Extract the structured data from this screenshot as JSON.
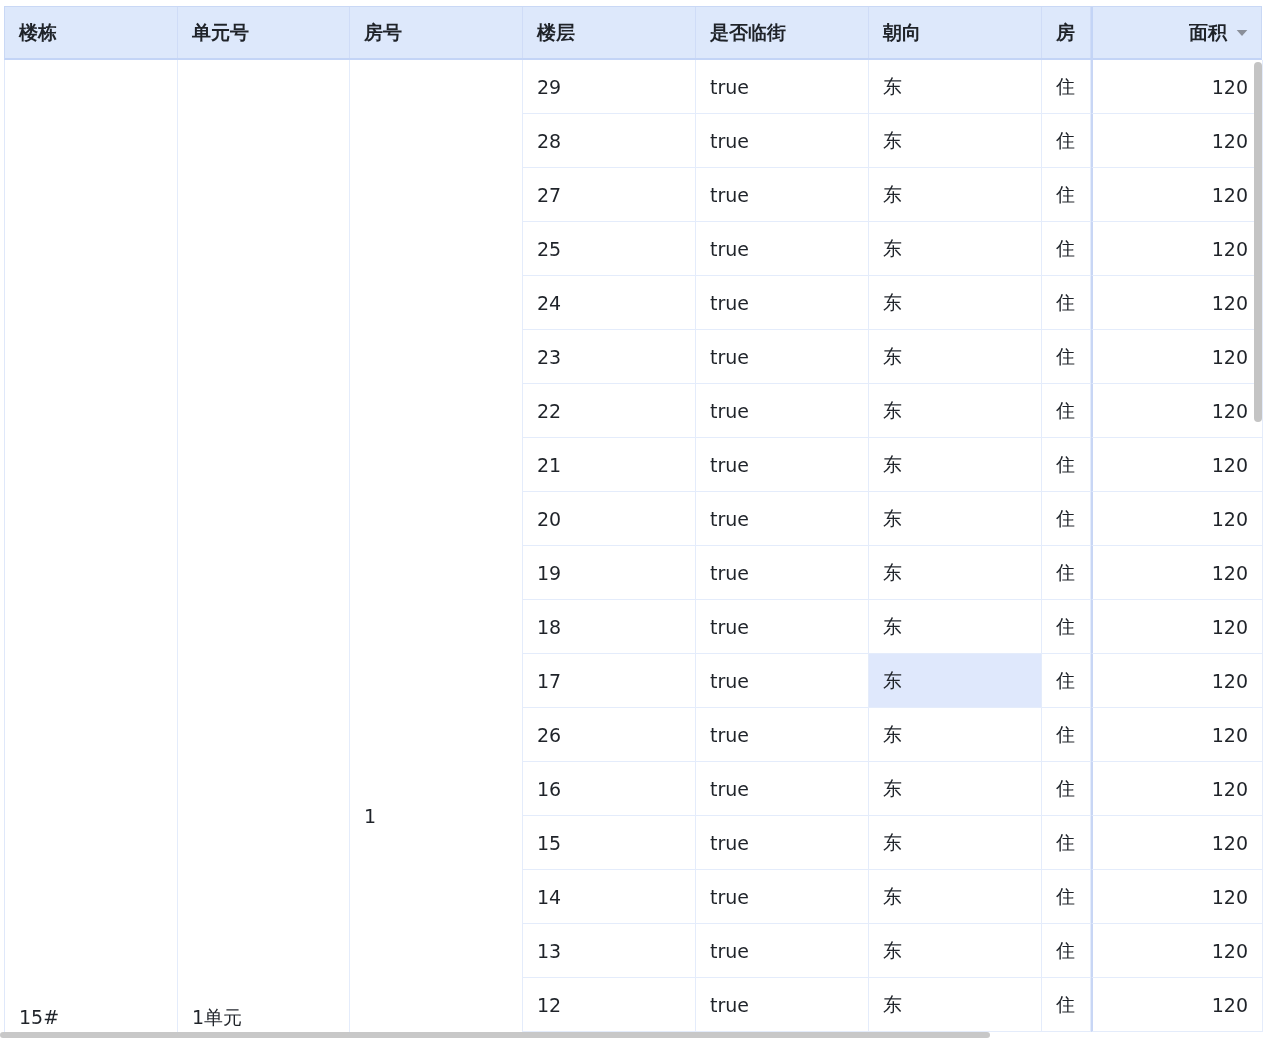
{
  "table": {
    "columns": [
      {
        "label": "楼栋"
      },
      {
        "label": "单元号"
      },
      {
        "label": "房号"
      },
      {
        "label": "楼层"
      },
      {
        "label": "是否临街"
      },
      {
        "label": "朝向"
      },
      {
        "label": "房"
      },
      {
        "label": "面积",
        "sorted": true
      }
    ],
    "merged": {
      "building": "15#",
      "unit": "1单元",
      "room": "1"
    },
    "rows": [
      {
        "floor": "29",
        "street": "true",
        "orientation": "东",
        "type": "住",
        "area": "120",
        "highlighted": false
      },
      {
        "floor": "28",
        "street": "true",
        "orientation": "东",
        "type": "住",
        "area": "120",
        "highlighted": false
      },
      {
        "floor": "27",
        "street": "true",
        "orientation": "东",
        "type": "住",
        "area": "120",
        "highlighted": false
      },
      {
        "floor": "25",
        "street": "true",
        "orientation": "东",
        "type": "住",
        "area": "120",
        "highlighted": false
      },
      {
        "floor": "24",
        "street": "true",
        "orientation": "东",
        "type": "住",
        "area": "120",
        "highlighted": false
      },
      {
        "floor": "23",
        "street": "true",
        "orientation": "东",
        "type": "住",
        "area": "120",
        "highlighted": false
      },
      {
        "floor": "22",
        "street": "true",
        "orientation": "东",
        "type": "住",
        "area": "120",
        "highlighted": false
      },
      {
        "floor": "21",
        "street": "true",
        "orientation": "东",
        "type": "住",
        "area": "120",
        "highlighted": false
      },
      {
        "floor": "20",
        "street": "true",
        "orientation": "东",
        "type": "住",
        "area": "120",
        "highlighted": false
      },
      {
        "floor": "19",
        "street": "true",
        "orientation": "东",
        "type": "住",
        "area": "120",
        "highlighted": false
      },
      {
        "floor": "18",
        "street": "true",
        "orientation": "东",
        "type": "住",
        "area": "120",
        "highlighted": false
      },
      {
        "floor": "17",
        "street": "true",
        "orientation": "东",
        "type": "住",
        "area": "120",
        "highlighted": true
      },
      {
        "floor": "26",
        "street": "true",
        "orientation": "东",
        "type": "住",
        "area": "120",
        "highlighted": false
      },
      {
        "floor": "16",
        "street": "true",
        "orientation": "东",
        "type": "住",
        "area": "120",
        "highlighted": false
      },
      {
        "floor": "15",
        "street": "true",
        "orientation": "东",
        "type": "住",
        "area": "120",
        "highlighted": false
      },
      {
        "floor": "14",
        "street": "true",
        "orientation": "东",
        "type": "住",
        "area": "120",
        "highlighted": false
      },
      {
        "floor": "13",
        "street": "true",
        "orientation": "东",
        "type": "住",
        "area": "120",
        "highlighted": false
      },
      {
        "floor": "12",
        "street": "true",
        "orientation": "东",
        "type": "住",
        "area": "120",
        "highlighted": false
      }
    ]
  }
}
